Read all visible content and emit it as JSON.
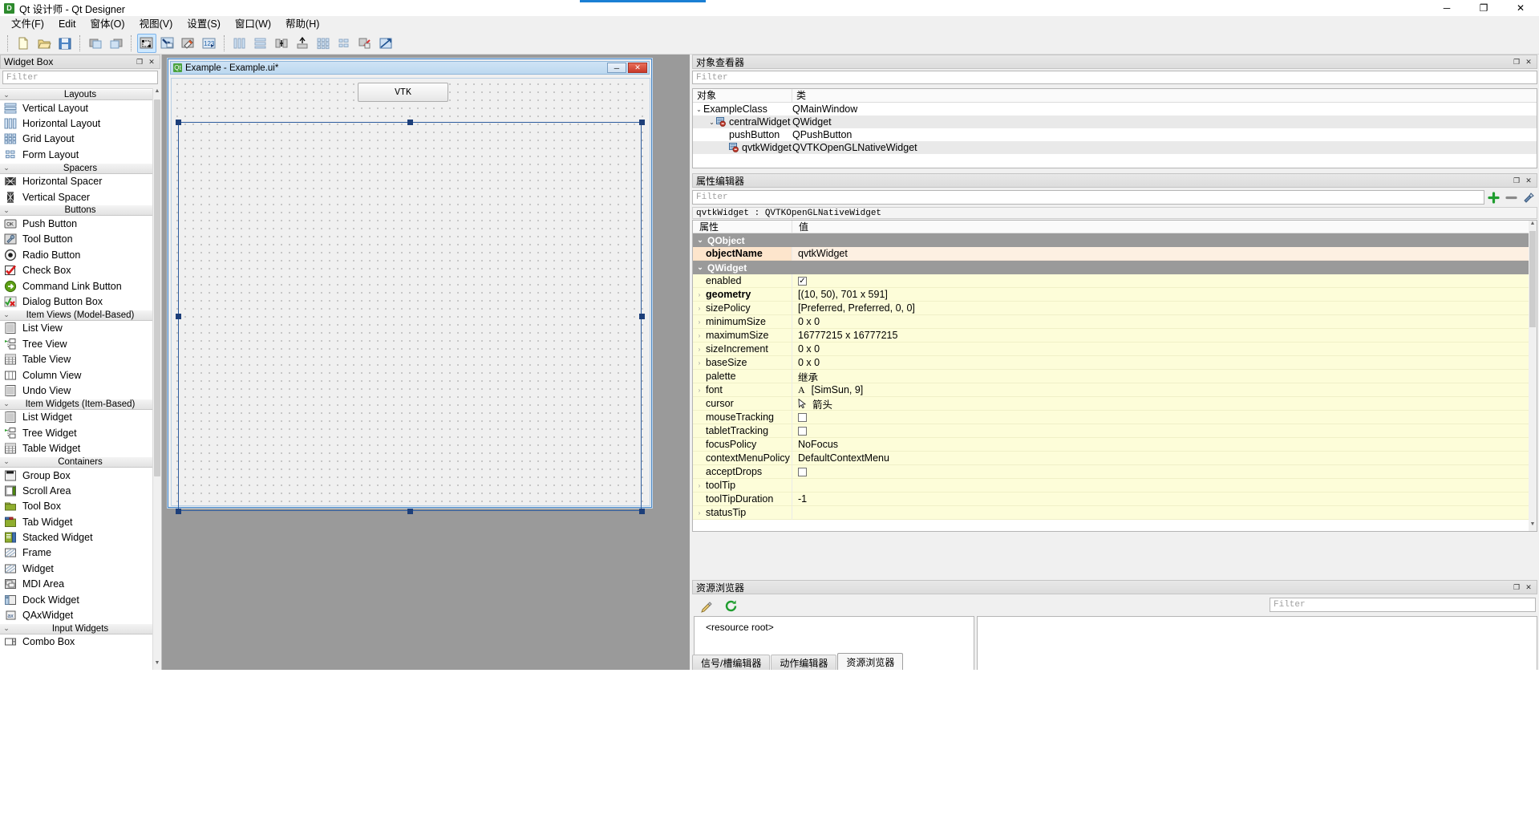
{
  "titlebar": {
    "app_icon": "D",
    "title": "Qt 设计师 - Qt Designer",
    "minimize": "─",
    "maximize": "❐",
    "close": "✕"
  },
  "menubar": {
    "items": [
      {
        "label": "文件(F)"
      },
      {
        "label": "Edit"
      },
      {
        "label": "窗体(O)"
      },
      {
        "label": "视图(V)"
      },
      {
        "label": "设置(S)"
      },
      {
        "label": "窗口(W)"
      },
      {
        "label": "帮助(H)"
      }
    ]
  },
  "toolbar": {
    "groups": [
      {
        "buttons": [
          {
            "name": "new-form",
            "icon": "new-file-icon",
            "active": false
          },
          {
            "name": "open-form",
            "icon": "open-folder-icon",
            "active": false
          },
          {
            "name": "save-form",
            "icon": "save-disk-icon",
            "active": false
          }
        ]
      },
      {
        "buttons": [
          {
            "name": "undo",
            "icon": "undo-icon",
            "active": false
          },
          {
            "name": "redo",
            "icon": "redo-icon",
            "active": false
          }
        ]
      },
      {
        "buttons": [
          {
            "name": "edit-widgets",
            "icon": "edit-widgets-icon",
            "active": true
          },
          {
            "name": "edit-signals-slots",
            "icon": "signal-slot-icon",
            "active": false
          },
          {
            "name": "edit-buddies",
            "icon": "buddy-icon",
            "active": false
          },
          {
            "name": "edit-tab-order",
            "icon": "tab-order-icon",
            "active": false
          }
        ]
      },
      {
        "buttons": [
          {
            "name": "layout-horizontally",
            "icon": "layout-horizontal-icon",
            "active": false
          },
          {
            "name": "layout-vertically",
            "icon": "layout-vertical-icon",
            "active": false
          },
          {
            "name": "layout-splitter-horizontal",
            "icon": "splitter-horizontal-icon",
            "active": false
          },
          {
            "name": "layout-splitter-vertical",
            "icon": "splitter-vertical-icon",
            "active": false
          },
          {
            "name": "layout-grid",
            "icon": "layout-grid-icon",
            "active": false
          },
          {
            "name": "layout-form",
            "icon": "layout-form-icon",
            "active": false
          },
          {
            "name": "break-layout",
            "icon": "break-layout-icon",
            "active": false
          },
          {
            "name": "adjust-size",
            "icon": "adjust-size-icon",
            "active": false
          }
        ]
      }
    ]
  },
  "widget_box": {
    "title": "Widget Box",
    "filter_placeholder": "Filter",
    "dock_float": "❐",
    "dock_close": "✕",
    "categories": [
      {
        "label": "Layouts",
        "chevron": "⌄",
        "items": [
          {
            "label": "Vertical Layout",
            "icon": "vertical-layout-icon"
          },
          {
            "label": "Horizontal Layout",
            "icon": "horizontal-layout-icon"
          },
          {
            "label": "Grid Layout",
            "icon": "grid-layout-icon"
          },
          {
            "label": "Form Layout",
            "icon": "form-layout-icon"
          }
        ]
      },
      {
        "label": "Spacers",
        "chevron": "⌄",
        "items": [
          {
            "label": "Horizontal Spacer",
            "icon": "horizontal-spacer-icon"
          },
          {
            "label": "Vertical Spacer",
            "icon": "vertical-spacer-icon"
          }
        ]
      },
      {
        "label": "Buttons",
        "chevron": "⌄",
        "items": [
          {
            "label": "Push Button",
            "icon": "push-button-icon"
          },
          {
            "label": "Tool Button",
            "icon": "tool-button-icon"
          },
          {
            "label": "Radio Button",
            "icon": "radio-button-icon"
          },
          {
            "label": "Check Box",
            "icon": "check-box-icon"
          },
          {
            "label": "Command Link Button",
            "icon": "command-link-button-icon"
          },
          {
            "label": "Dialog Button Box",
            "icon": "dialog-button-box-icon"
          }
        ]
      },
      {
        "label": "Item Views (Model-Based)",
        "chevron": "⌄",
        "items": [
          {
            "label": "List View",
            "icon": "list-view-icon"
          },
          {
            "label": "Tree View",
            "icon": "tree-view-icon"
          },
          {
            "label": "Table View",
            "icon": "table-view-icon"
          },
          {
            "label": "Column View",
            "icon": "column-view-icon"
          },
          {
            "label": "Undo View",
            "icon": "undo-view-icon"
          }
        ]
      },
      {
        "label": "Item Widgets (Item-Based)",
        "chevron": "⌄",
        "items": [
          {
            "label": "List Widget",
            "icon": "list-widget-icon"
          },
          {
            "label": "Tree Widget",
            "icon": "tree-widget-icon"
          },
          {
            "label": "Table Widget",
            "icon": "table-widget-icon"
          }
        ]
      },
      {
        "label": "Containers",
        "chevron": "⌄",
        "items": [
          {
            "label": "Group Box",
            "icon": "group-box-icon"
          },
          {
            "label": "Scroll Area",
            "icon": "scroll-area-icon"
          },
          {
            "label": "Tool Box",
            "icon": "tool-box-icon"
          },
          {
            "label": "Tab Widget",
            "icon": "tab-widget-icon"
          },
          {
            "label": "Stacked Widget",
            "icon": "stacked-widget-icon"
          },
          {
            "label": "Frame",
            "icon": "frame-icon"
          },
          {
            "label": "Widget",
            "icon": "widget-icon"
          },
          {
            "label": "MDI Area",
            "icon": "mdi-area-icon"
          },
          {
            "label": "Dock Widget",
            "icon": "dock-widget-icon"
          },
          {
            "label": "QAxWidget",
            "icon": "qax-widget-icon"
          }
        ]
      },
      {
        "label": "Input Widgets",
        "chevron": "⌄",
        "items": [
          {
            "label": "Combo Box",
            "icon": "combo-box-icon"
          }
        ]
      }
    ]
  },
  "form_window": {
    "icon_letter": "Qt",
    "title": "Example - Example.ui*",
    "minimize": "─",
    "close": "✕",
    "push_button_label": "VTK"
  },
  "object_inspector": {
    "title": "对象查看器",
    "filter_placeholder": "Filter",
    "dock_float": "❐",
    "dock_close": "✕",
    "columns": [
      "对象",
      "类"
    ],
    "rows": [
      {
        "name": "ExampleClass",
        "class": "QMainWindow",
        "indent": 0,
        "twisty": "⌄",
        "icon": null,
        "selected": false
      },
      {
        "name": "centralWidget",
        "class": "QWidget",
        "indent": 1,
        "twisty": "⌄",
        "icon": "widget-error-icon",
        "selected": true
      },
      {
        "name": "pushButton",
        "class": "QPushButton",
        "indent": 2,
        "twisty": "",
        "icon": null,
        "selected": false
      },
      {
        "name": "qvtkWidget",
        "class": "QVTKOpenGLNativeWidget",
        "indent": 2,
        "twisty": "",
        "icon": "widget-error-icon",
        "selected": true
      }
    ]
  },
  "property_editor": {
    "title": "属性编辑器",
    "filter_placeholder": "Filter",
    "dock_float": "❐",
    "dock_close": "✕",
    "object_line": "qvtkWidget : QVTKOpenGLNativeWidget",
    "columns": [
      "属性",
      "值"
    ],
    "add_button": "+",
    "remove_button": "─",
    "config_button": "configure-icon",
    "rows": [
      {
        "type": "group",
        "label": "QObject",
        "chevron": "⌄"
      },
      {
        "type": "prop",
        "key": "objectName",
        "value": "qvtkWidget",
        "expand": "",
        "bold": true,
        "highlight": "objname"
      },
      {
        "type": "group",
        "label": "QWidget",
        "chevron": "⌄"
      },
      {
        "type": "prop",
        "key": "enabled",
        "value": "",
        "expand": "",
        "check": "checked"
      },
      {
        "type": "prop",
        "key": "geometry",
        "value": "[(10, 50), 701 x 591]",
        "expand": "›",
        "bold": true
      },
      {
        "type": "prop",
        "key": "sizePolicy",
        "value": "[Preferred, Preferred, 0, 0]",
        "expand": "›"
      },
      {
        "type": "prop",
        "key": "minimumSize",
        "value": "0 x 0",
        "expand": "›"
      },
      {
        "type": "prop",
        "key": "maximumSize",
        "value": "16777215 x 16777215",
        "expand": "›"
      },
      {
        "type": "prop",
        "key": "sizeIncrement",
        "value": "0 x 0",
        "expand": "›"
      },
      {
        "type": "prop",
        "key": "baseSize",
        "value": "0 x 0",
        "expand": "›"
      },
      {
        "type": "prop",
        "key": "palette",
        "value": "继承",
        "expand": ""
      },
      {
        "type": "prop",
        "key": "font",
        "value": "[SimSun, 9]",
        "expand": "›",
        "glyph": "A"
      },
      {
        "type": "prop",
        "key": "cursor",
        "value": "箭头",
        "expand": "",
        "glyph": "cursor-arrow-icon"
      },
      {
        "type": "prop",
        "key": "mouseTracking",
        "value": "",
        "expand": "",
        "check": "unchecked"
      },
      {
        "type": "prop",
        "key": "tabletTracking",
        "value": "",
        "expand": "",
        "check": "unchecked"
      },
      {
        "type": "prop",
        "key": "focusPolicy",
        "value": "NoFocus",
        "expand": ""
      },
      {
        "type": "prop",
        "key": "contextMenuPolicy",
        "value": "DefaultContextMenu",
        "expand": ""
      },
      {
        "type": "prop",
        "key": "acceptDrops",
        "value": "",
        "expand": "",
        "check": "unchecked"
      },
      {
        "type": "prop",
        "key": "toolTip",
        "value": "",
        "expand": "›"
      },
      {
        "type": "prop",
        "key": "toolTipDuration",
        "value": "-1",
        "expand": ""
      },
      {
        "type": "prop",
        "key": "statusTip",
        "value": "",
        "expand": "›"
      }
    ]
  },
  "resource_browser": {
    "title": "资源浏览器",
    "dock_float": "❐",
    "dock_close": "✕",
    "filter_placeholder": "Filter",
    "edit_button": "pencil-icon",
    "reload_button": "reload-icon",
    "root_label": "<resource root>"
  },
  "bottom_tabs": {
    "tabs": [
      {
        "label": "信号/槽编辑器",
        "active": false
      },
      {
        "label": "动作编辑器",
        "active": false
      },
      {
        "label": "资源浏览器",
        "active": true
      }
    ]
  }
}
